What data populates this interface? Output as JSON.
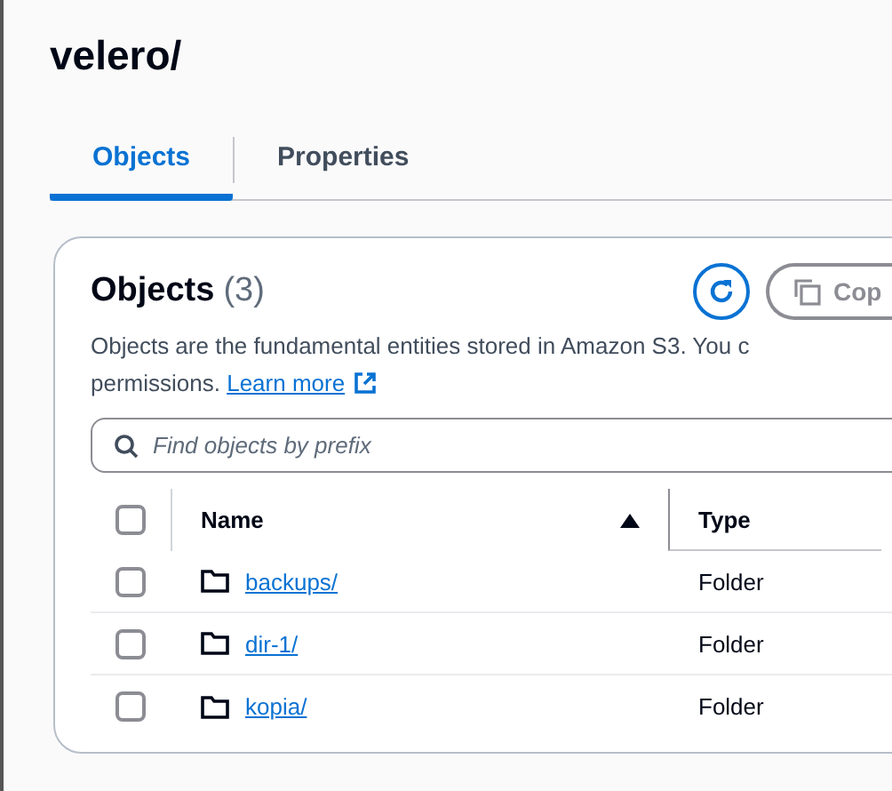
{
  "page_title": "velero/",
  "tabs": [
    {
      "label": "Objects",
      "selected": true
    },
    {
      "label": "Properties",
      "selected": false
    }
  ],
  "objects_panel": {
    "title": "Objects",
    "count": "(3)",
    "copy_button": "Cop",
    "description_line_1": "Objects are the fundamental entities stored in Amazon S3. You c",
    "description_line_2": "permissions.",
    "learn_more": "Learn more",
    "search": {
      "placeholder": "Find objects by prefix"
    },
    "table": {
      "all_checked": false,
      "sorted_ascending": true,
      "columns": [
        {
          "label": "Name"
        },
        {
          "label": "Type"
        }
      ],
      "rows": [
        {
          "checked": false,
          "name": "backups/",
          "type": "Folder"
        },
        {
          "checked": false,
          "name": "dir-1/",
          "type": "Folder"
        },
        {
          "checked": false,
          "name": "kopia/",
          "type": "Folder"
        }
      ]
    }
  }
}
